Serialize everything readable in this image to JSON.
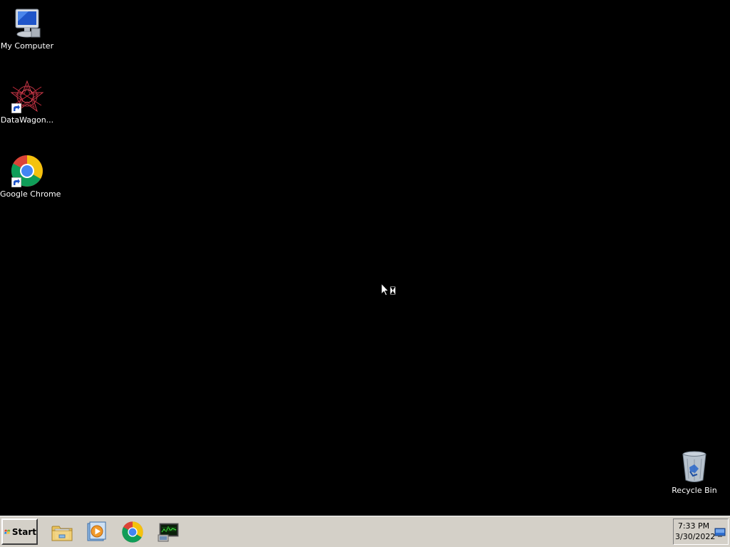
{
  "desktop": {
    "icons": [
      {
        "label": "My Computer",
        "icon": "my-computer-icon"
      },
      {
        "label": "DataWagon...",
        "icon": "datawagon-icon"
      },
      {
        "label": "Google Chrome",
        "icon": "chrome-icon"
      },
      {
        "label": "Recycle Bin",
        "icon": "recycle-bin-icon"
      }
    ]
  },
  "taskbar": {
    "start_label": "Start",
    "pinned": [
      {
        "icon": "folder-explorer-icon"
      },
      {
        "icon": "media-player-icon"
      },
      {
        "icon": "chrome-icon"
      },
      {
        "icon": "network-monitor-icon"
      }
    ]
  },
  "tray": {
    "time": "7:33 PM",
    "date": "3/30/2022"
  },
  "colors": {
    "desktop_bg": "#000000",
    "taskbar_bg": "#d4d0c8",
    "label_text": "#ffffff"
  }
}
